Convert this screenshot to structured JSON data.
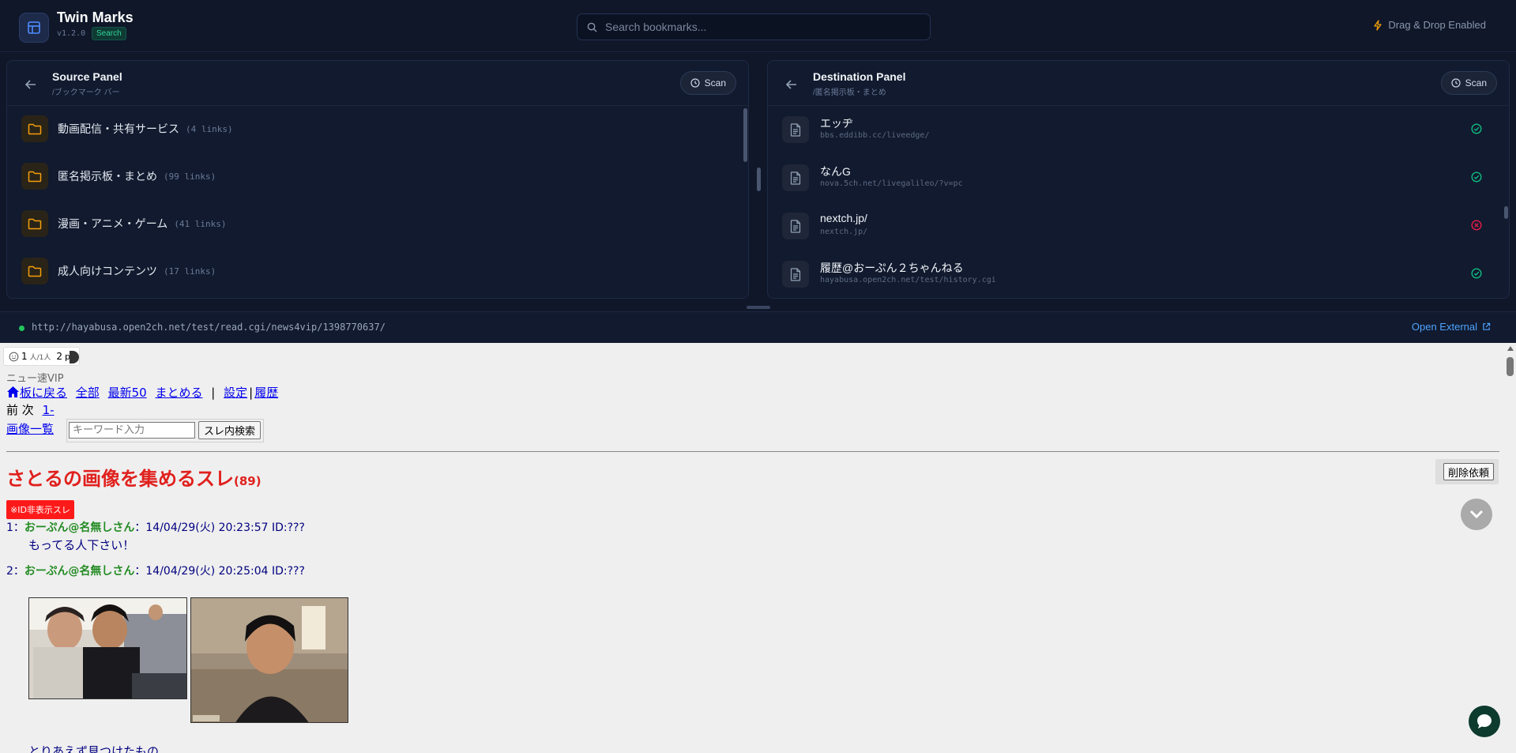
{
  "app": {
    "title": "Twin Marks",
    "version": "v1.2.0",
    "badge": "Search",
    "search_placeholder": "Search bookmarks...",
    "dnd_label": "Drag & Drop Enabled",
    "accent_color": "#34d399",
    "icons": [
      "layout-icon",
      "search-icon",
      "lightning-icon"
    ]
  },
  "source_panel": {
    "title": "Source Panel",
    "path": "/ブックマーク バー",
    "scan_label": "Scan",
    "folders": [
      {
        "name": "動画配信・共有サービス",
        "count": "(4 links)"
      },
      {
        "name": "匿名掲示板・まとめ",
        "count": "(99 links)"
      },
      {
        "name": "漫画・アニメ・ゲーム",
        "count": "(41 links)"
      },
      {
        "name": "成人向けコンテンツ",
        "count": "(17 links)"
      }
    ]
  },
  "destination_panel": {
    "title": "Destination Panel",
    "path": "/匿名掲示板・まとめ",
    "scan_label": "Scan",
    "links": [
      {
        "title": "エッヂ",
        "url": "bbs.eddibb.cc/liveedge/",
        "status": "ok"
      },
      {
        "title": "なんG",
        "url": "nova.5ch.net/livegalileo/?v=pc",
        "status": "ok"
      },
      {
        "title": "nextch.jp/",
        "url": "nextch.jp/",
        "status": "error"
      },
      {
        "title": "履歴@おーぷん２ちゃんねる",
        "url": "hayabusa.open2ch.net/test/history.cgi",
        "status": "ok"
      }
    ],
    "status_colors": {
      "ok": "#10b981",
      "error": "#e11d48"
    }
  },
  "urlbar": {
    "url": "http://hayabusa.open2ch.net/test/read.cgi/news4vip/1398770637/",
    "open_external": "Open External"
  },
  "web": {
    "counter": {
      "count1": "1",
      "unit1": "人/1人",
      "count2": "2",
      "unit2": "pv"
    },
    "board_name": "ニュー速VIP",
    "nav": {
      "back": "板に戻る",
      "all": "全部",
      "latest": "最新50",
      "summarize": "まとめる",
      "sep1": "|",
      "settings": "設定",
      "sep2": "|",
      "history": "履歴"
    },
    "pager": {
      "prev": "前",
      "next": "次",
      "range": "1-"
    },
    "image_list": "画像一覧",
    "keyword_placeholder": "キーワード入力",
    "search_button": "スレ内検索",
    "thread_title": "さとるの画像を集めるスレ",
    "thread_count": "(89)",
    "delete_button": "削除依頼",
    "id_badge": "※ID非表示スレ",
    "posts": [
      {
        "num": "1",
        "sep": "：",
        "name": "おーぷん@名無しさん",
        "date": "：14/04/29(火) 20:23:57",
        "id": "ID:???",
        "body": "もってる人下さい！"
      },
      {
        "num": "2",
        "sep": "：",
        "name": "おーぷん@名無しさん",
        "date": "：14/04/29(火) 20:25:04",
        "id": "ID:???",
        "body": ""
      }
    ],
    "trailing_text": "とりあえず見つけたもの"
  }
}
